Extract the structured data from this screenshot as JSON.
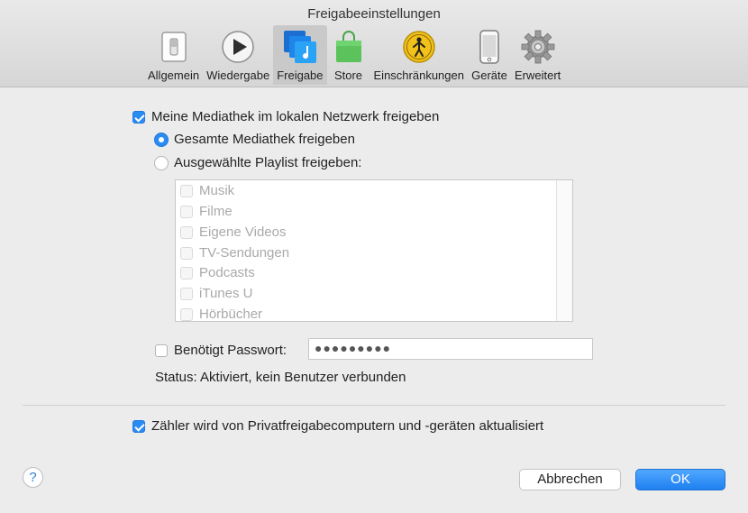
{
  "window": {
    "title": "Freigabeeinstellungen"
  },
  "tabs": [
    {
      "label": "Allgemein",
      "icon": "switch-icon",
      "active": false
    },
    {
      "label": "Wiedergabe",
      "icon": "play-icon",
      "active": false
    },
    {
      "label": "Freigabe",
      "icon": "sharing-music-icon",
      "active": true
    },
    {
      "label": "Store",
      "icon": "shopping-bag-icon",
      "active": false
    },
    {
      "label": "Einschränkungen",
      "icon": "parental-controls-icon",
      "active": false
    },
    {
      "label": "Geräte",
      "icon": "iphone-icon",
      "active": false
    },
    {
      "label": "Erweitert",
      "icon": "gear-icon",
      "active": false
    }
  ],
  "sharing": {
    "share_library_label": "Meine Mediathek im lokalen Netzwerk freigeben",
    "share_library_checked": true,
    "radio_entire_label": "Gesamte Mediathek freigeben",
    "radio_selected_label": "Ausgewählte Playlist freigeben:",
    "selected_option": "entire",
    "playlists": [
      "Musik",
      "Filme",
      "Eigene Videos",
      "TV-Sendungen",
      "Podcasts",
      "iTunes U",
      "Hörbücher"
    ],
    "password_label": "Benötigt Passwort:",
    "password_checked": false,
    "password_value": "●●●●●●●●●",
    "status_text": "Status: Aktiviert, kein Benutzer verbunden",
    "counter_label": "Zähler wird von Privatfreigabecomputern und -geräten aktualisiert",
    "counter_checked": true
  },
  "footer": {
    "help_label": "?",
    "cancel_label": "Abbrechen",
    "ok_label": "OK"
  },
  "colors": {
    "accent": "#2a8cf3",
    "disabled_text": "#a9a9a9"
  }
}
